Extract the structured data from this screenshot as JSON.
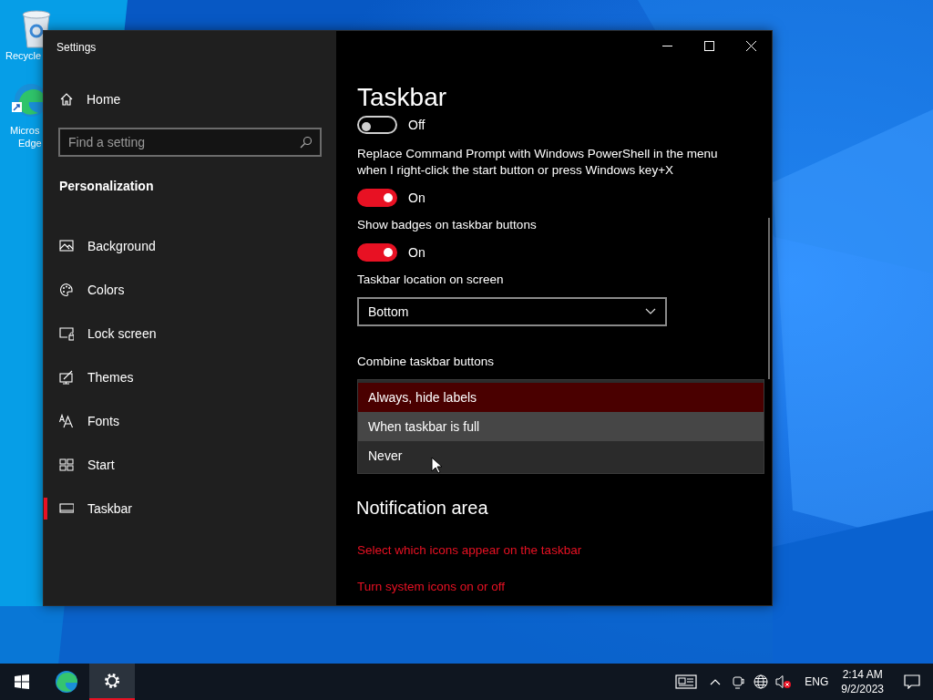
{
  "desktop_icons": [
    {
      "label": "Recycle",
      "kind": "bin"
    },
    {
      "label": "Micros",
      "label2": "Edge",
      "kind": "edge"
    }
  ],
  "window": {
    "title": "Settings"
  },
  "sidebar": {
    "home": "Home",
    "search": {
      "placeholder": "Find a setting"
    },
    "section": "Personalization",
    "items": [
      {
        "label": "Background",
        "selected": false
      },
      {
        "label": "Colors",
        "selected": false
      },
      {
        "label": "Lock screen",
        "selected": false
      },
      {
        "label": "Themes",
        "selected": false
      },
      {
        "label": "Fonts",
        "selected": false
      },
      {
        "label": "Start",
        "selected": false
      },
      {
        "label": "Taskbar",
        "selected": true
      }
    ]
  },
  "page": {
    "title": "Taskbar",
    "settings": [
      {
        "kind": "toggle",
        "on": false,
        "state_label": "Off"
      },
      {
        "kind": "toggle",
        "label": "Replace Command Prompt with Windows PowerShell in the menu when I right-click the start button or press Windows key+X",
        "on": true,
        "state_label": "On"
      },
      {
        "kind": "toggle",
        "label": "Show badges on taskbar buttons",
        "on": true,
        "state_label": "On"
      },
      {
        "kind": "dropdown",
        "label": "Taskbar location on screen",
        "value": "Bottom"
      },
      {
        "kind": "open_list",
        "label": "Combine taskbar buttons",
        "options": [
          {
            "label": "Always, hide labels",
            "selected": true,
            "hovered": false
          },
          {
            "label": "When taskbar is full",
            "selected": false,
            "hovered": true
          },
          {
            "label": "Never",
            "selected": false,
            "hovered": false
          }
        ]
      }
    ],
    "section": "Notification area",
    "links": [
      "Select which icons appear on the taskbar",
      "Turn system icons on or off"
    ]
  },
  "taskbar": {
    "apps": [
      {
        "kind": "edge",
        "active": false
      },
      {
        "kind": "settings",
        "active": true
      }
    ],
    "language": "ENG",
    "time": "2:14 AM",
    "date": "9/2/2023"
  }
}
